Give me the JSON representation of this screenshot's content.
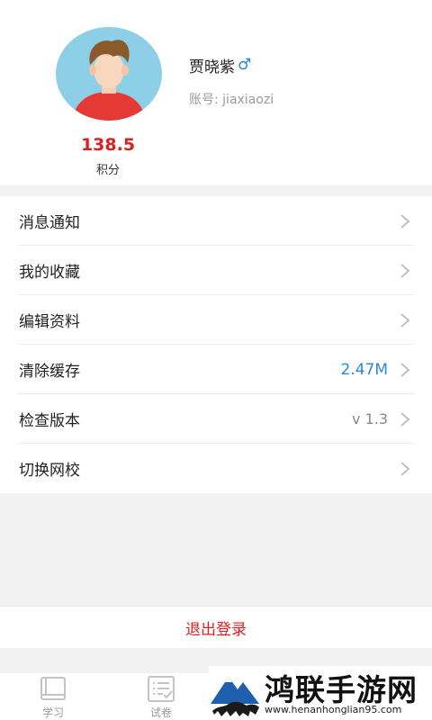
{
  "profile": {
    "name": "贾晓紫",
    "gender_symbol": "♂",
    "account": "账号: jiaxiaozi",
    "points_value": "138.5",
    "points_label": "积分"
  },
  "menu": {
    "items": [
      {
        "label": "消息通知",
        "value": ""
      },
      {
        "label": "我的收藏",
        "value": ""
      },
      {
        "label": "编辑资料",
        "value": ""
      },
      {
        "label": "清除缓存",
        "value": "2.47M"
      },
      {
        "label": "检查版本",
        "value": "v 1.3"
      },
      {
        "label": "切换网校",
        "value": ""
      }
    ]
  },
  "logout": {
    "label": "退出登录"
  },
  "tabbar": {
    "tabs": [
      {
        "label": "学习",
        "icon": "book-icon"
      },
      {
        "label": "试卷",
        "icon": "checklist-icon"
      }
    ]
  },
  "watermark": {
    "text": "鸿联手游网",
    "url": "www.henanhonglian95.com"
  },
  "colors": {
    "accent_red": "#e02020",
    "accent_blue": "#2b88d6",
    "avatar_bg": "#8ecfe8"
  }
}
